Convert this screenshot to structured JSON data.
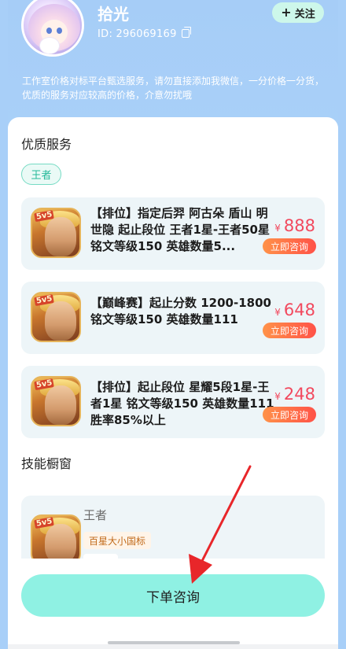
{
  "header": {
    "name": "拾光",
    "id_text": "ID:  296069169",
    "follow_label": "关注",
    "description": "工作室价格对标平台甄选服务，请勿直接添加我微信，一分价格一分货，优质的服务对应较高的价格，介意勿扰哦"
  },
  "quality_section": {
    "title": "优质服务",
    "tag": "王者"
  },
  "services": [
    {
      "text": "【排位】指定后羿 阿古朵 盾山 明世隐 起止段位 王者1星-王者50星 铭文等级150 英雄数量5...",
      "price": "888",
      "currency": "¥",
      "consult_label": "立即咨询",
      "icon_badge": "5v5"
    },
    {
      "text": "【巅峰赛】起止分数 1200-1800 铭文等级150 英雄数量111",
      "price": "648",
      "currency": "¥",
      "consult_label": "立即咨询",
      "icon_badge": "5v5"
    },
    {
      "text": "【排位】起止段位 星耀5段1星-王者1星 铭文等级150 英雄数量111 胜率85%以上",
      "price": "248",
      "currency": "¥",
      "consult_label": "立即咨询",
      "icon_badge": "5v5"
    }
  ],
  "skills_section": {
    "title": "技能橱窗",
    "item_name": "王者",
    "item_tag": "百星大小国标",
    "icon_badge": "5v5"
  },
  "footer": {
    "order_label": "下单咨询"
  },
  "colors": {
    "hero_bg": "#a8cff8",
    "price": "#f2495e",
    "order_button": "#8ff1e3",
    "arrow": "#e8262a"
  }
}
